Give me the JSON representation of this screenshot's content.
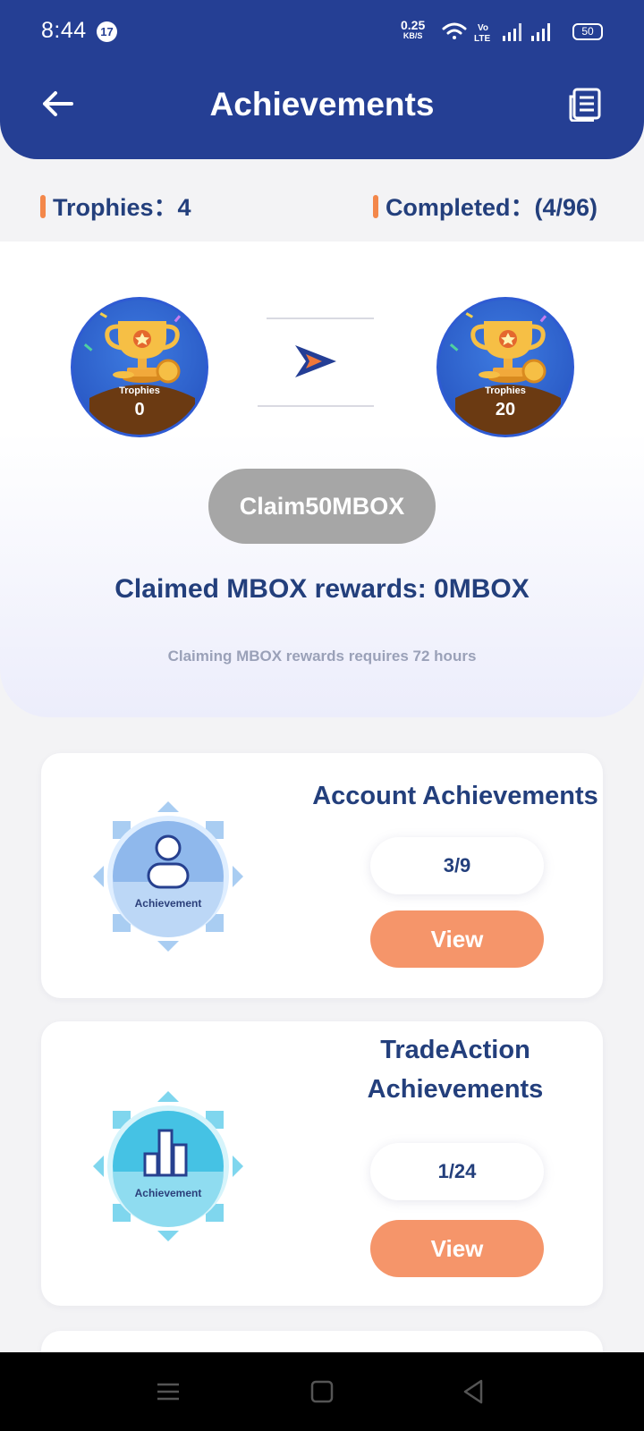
{
  "status_bar": {
    "time": "8:44",
    "notification_count": "17",
    "net_speed_value": "0.25",
    "net_speed_unit": "KB/S",
    "volte_label": "Vo LTE",
    "battery": "50"
  },
  "header": {
    "title": "Achievements",
    "back_icon": "arrow-left-icon",
    "right_icon": "document-list-icon"
  },
  "summary": {
    "trophies_label": "Trophies：",
    "trophies_value": "4",
    "completed_label": "Completed：",
    "completed_value": "(4/96)"
  },
  "claim": {
    "from_trophy_label": "Trophies",
    "from_trophy_value": "0",
    "to_trophy_label": "Trophies",
    "to_trophy_value": "20",
    "button_label": "Claim50MBOX",
    "claimed_text": "Claimed MBOX rewards: 0MBOX",
    "note": "Claiming MBOX rewards requires 72 hours"
  },
  "cards": [
    {
      "title": "Account Achievements",
      "badge_label": "Achievement",
      "badge_icon": "person-icon",
      "progress": "3/9",
      "button_label": "View"
    },
    {
      "title_line1": "TradeAction",
      "title_line2": "Achievements",
      "badge_label": "Achievement",
      "badge_icon": "bar-chart-icon",
      "progress": "1/24",
      "button_label": "View"
    }
  ],
  "colors": {
    "header_bg": "#253f94",
    "accent_orange": "#f5956a",
    "title_text": "#233f7c",
    "disabled_button": "#a6a6a6"
  }
}
